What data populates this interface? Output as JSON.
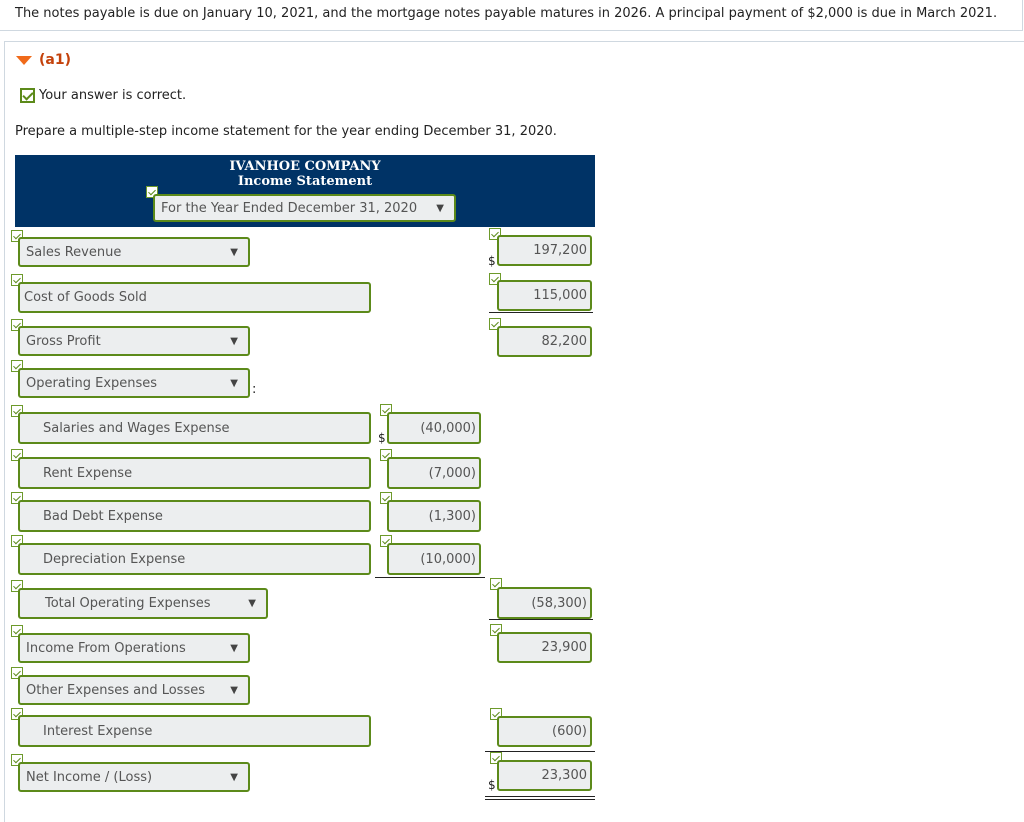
{
  "problem_text": "The notes payable is due on January 10, 2021, and the mortgage notes payable matures in 2026. A principal payment of $2,000 is due in March 2021.",
  "part": {
    "label": "(a1)",
    "icon": "triangle-down-icon"
  },
  "feedback": {
    "text": "Your answer is correct.",
    "icon": "checkmark-icon"
  },
  "instructions": "Prepare a multiple-step income statement for the year ending December 31, 2020.",
  "statement": {
    "company": "IVANHOE COMPANY",
    "title": "Income Statement",
    "period": "For the Year Ended December 31, 2020"
  },
  "rows": [
    {
      "label": "Sales Revenue",
      "amount": "197,200",
      "currency": "$"
    },
    {
      "label": "Cost of Goods Sold",
      "amount": "115,000"
    },
    {
      "label": "Gross Profit",
      "amount": "82,200"
    },
    {
      "label": "Operating Expenses",
      "suffix": ":"
    },
    {
      "label": "Salaries and Wages Expense",
      "amount": "(40,000)",
      "currency": "$"
    },
    {
      "label": "Rent Expense",
      "amount": "(7,000)"
    },
    {
      "label": "Bad Debt Expense",
      "amount": "(1,300)"
    },
    {
      "label": "Depreciation Expense",
      "amount": "(10,000)"
    },
    {
      "label": "Total Operating Expenses",
      "amount": "(58,300)"
    },
    {
      "label": "Income From Operations",
      "amount": "23,900"
    },
    {
      "label": "Other Expenses and Losses"
    },
    {
      "label": "Interest Expense",
      "amount": "(600)"
    },
    {
      "label": "Net Income / (Loss)",
      "amount": "23,300",
      "currency": "$"
    }
  ],
  "dropdown_arrow": "▼"
}
